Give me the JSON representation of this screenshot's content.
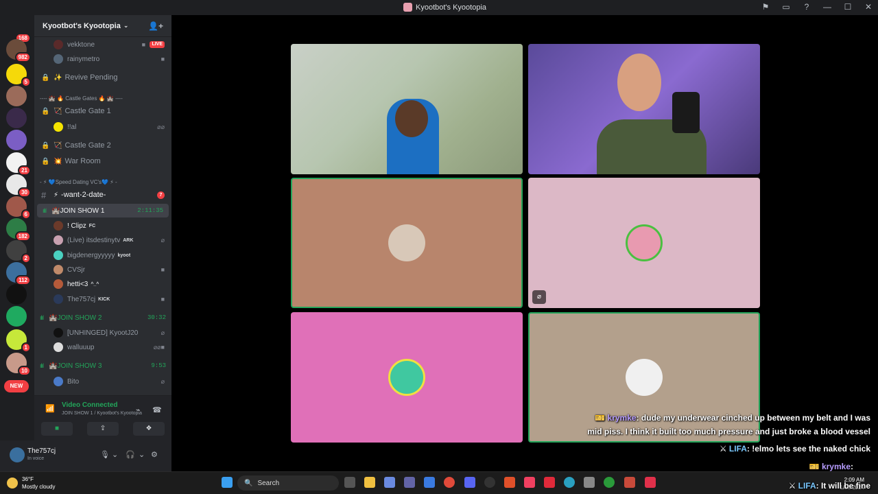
{
  "window": {
    "title": "Kyootbot's Kyootopia"
  },
  "rail": {
    "servers": [
      {
        "badge": "168",
        "color": "#1e1f22"
      },
      {
        "badge": "982",
        "color": "#6b4c3b"
      },
      {
        "badge": "5",
        "color": "#f5d90a"
      },
      {
        "badge": "",
        "color": "#9b6b5a"
      },
      {
        "badge": "",
        "color": "#3a2a4a"
      },
      {
        "badge": "",
        "color": "#7b5ec4"
      },
      {
        "badge": "21",
        "color": "#f2f2f2"
      },
      {
        "badge": "30",
        "color": "#e8e8e8"
      },
      {
        "badge": "6",
        "color": "#a0584a"
      },
      {
        "badge": "182",
        "color": "#2d7d46"
      },
      {
        "badge": "2",
        "color": "#404040"
      },
      {
        "badge": "112",
        "color": "#3c6f9e"
      },
      {
        "badge": "",
        "color": "#111111"
      },
      {
        "badge": "",
        "color": "#1faa60"
      },
      {
        "badge": "1",
        "color": "#c6e83a"
      },
      {
        "badge": "10",
        "color": "#c89a8a"
      }
    ],
    "new_label": "NEW"
  },
  "server": {
    "name": "Kyootbot's Kyootopia"
  },
  "channels": {
    "top_users": [
      {
        "name": "vekktone",
        "live": "LIVE"
      },
      {
        "name": "rainymetro"
      }
    ],
    "revive_pending": "Revive Pending",
    "category_castle": "---- 🏰 🔥 Castle Gates 🔥 🏰 ----",
    "castle_gate_1": "Castle Gate 1",
    "castle_gate_1_user": "!!al",
    "castle_gate_2": "Castle Gate 2",
    "war_room": "War Room",
    "category_speed": "- ⚡ 💙Speed Dating VC's💙 ⚡ -",
    "want_2_date": "-want-2-date-",
    "want_2_date_count": "7",
    "join_show_1": {
      "name": "JOIN SHOW 1",
      "timer": "2:11:35"
    },
    "show1_users": [
      {
        "name": "! Clipz",
        "tag": "FC",
        "color": "#6b3a2a"
      },
      {
        "name": "(Live) itsdestinytv",
        "tag": "ARK",
        "color": "#c8a0b0"
      },
      {
        "name": "bigdenergyyyyy",
        "tag": "kyoot",
        "color": "#4ad0c0"
      },
      {
        "name": "CVSjr",
        "tag": "",
        "color": "#c08a6a"
      },
      {
        "name": "hetti<3",
        "tag": "^_^",
        "color": "#b45a3a"
      },
      {
        "name": "The757cj",
        "tag": "KICK",
        "color": "#2a3a5a"
      }
    ],
    "join_show_2": {
      "name": "JOIN SHOW 2",
      "timer": "30:32"
    },
    "show2_users": [
      {
        "name": "[UNHINGED] KyootJ20",
        "color": "#111111"
      },
      {
        "name": "walluuup",
        "color": "#dddddd"
      }
    ],
    "join_show_3": {
      "name": "JOIN SHOW 3",
      "timer": "9:53"
    },
    "show3_users": [
      {
        "name": "Bito",
        "color": "#4a7ac8"
      }
    ]
  },
  "voice_panel": {
    "status": "Video Connected",
    "location": "JOIN SHOW 1 / Kyootbot's Kyootopia"
  },
  "user_panel": {
    "name": "The757cj",
    "status": "In voice"
  },
  "chat": [
    {
      "name": "krymke",
      "text": ": dude my underwear cinched up between my belt and I was"
    },
    {
      "name": "",
      "text": "mid piss. I think it built too much pressure and just broke a blood vessel"
    },
    {
      "name": "LIFA",
      "text": ": !elmo lets see the naked chick"
    },
    {
      "name": "krymke",
      "text": ":"
    },
    {
      "name": "LIFA",
      "text": ": It will be fine"
    }
  ],
  "taskbar": {
    "weather_temp": "36°F",
    "weather_desc": "Mostly cloudy",
    "search_placeholder": "Search",
    "time": "2:09 AM",
    "date": "1/18/2024"
  },
  "colors": {
    "tile_tan": "#b8856c",
    "tile_lightpink": "#dcb8c6",
    "tile_pink": "#e070b8",
    "tile_taupe": "#b3a08c",
    "speaking": "#23a55a"
  }
}
